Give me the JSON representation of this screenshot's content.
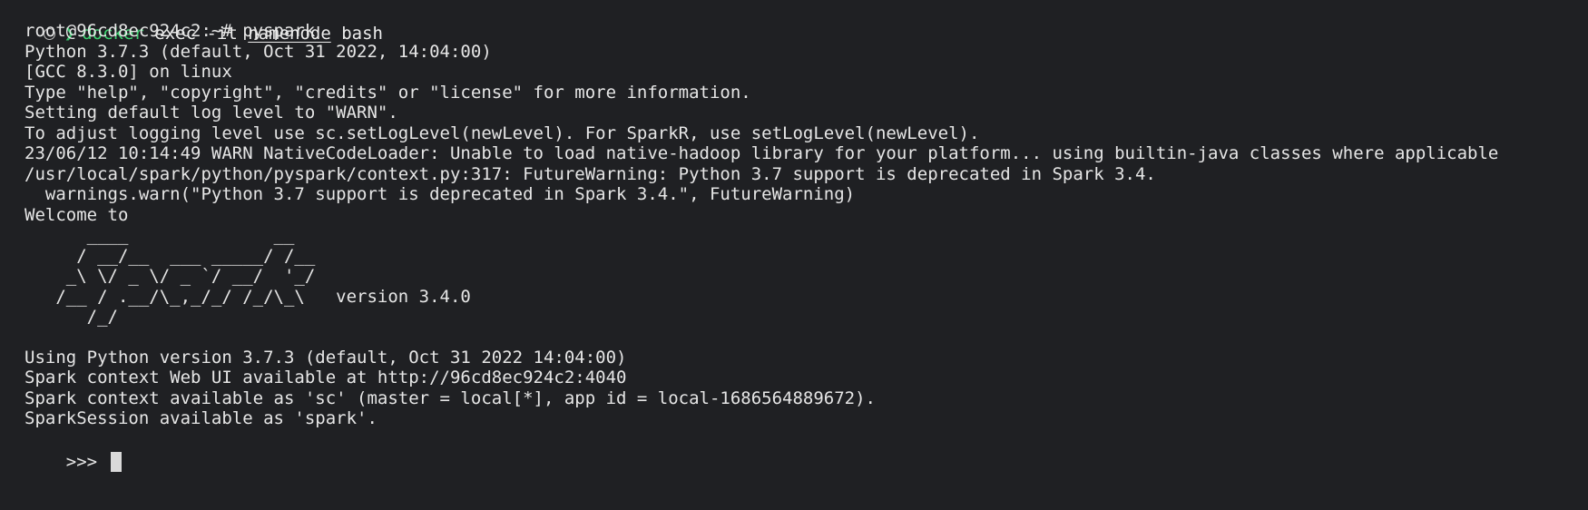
{
  "prompt": {
    "chevron": "❯",
    "command": "docker",
    "args_before": " exec -it ",
    "arg_underlined": "namenode",
    "args_after": " bash"
  },
  "lines": [
    "root@96cd8ec924c2:~# pyspark",
    "Python 3.7.3 (default, Oct 31 2022, 14:04:00)",
    "[GCC 8.3.0] on linux",
    "Type \"help\", \"copyright\", \"credits\" or \"license\" for more information.",
    "Setting default log level to \"WARN\".",
    "To adjust logging level use sc.setLogLevel(newLevel). For SparkR, use setLogLevel(newLevel).",
    "23/06/12 10:14:49 WARN NativeCodeLoader: Unable to load native-hadoop library for your platform... using builtin-java classes where applicable",
    "/usr/local/spark/python/pyspark/context.py:317: FutureWarning: Python 3.7 support is deprecated in Spark 3.4.",
    "  warnings.warn(\"Python 3.7 support is deprecated in Spark 3.4.\", FutureWarning)",
    "Welcome to"
  ],
  "ascii_art": [
    "      ____              __",
    "     / __/__  ___ _____/ /__",
    "    _\\ \\/ _ \\/ _ `/ __/  '_/",
    "   /__ / .__/\\_,_/_/ /_/\\_\\   version 3.4.0",
    "      /_/"
  ],
  "info_lines": [
    "Using Python version 3.7.3 (default, Oct 31 2022 14:04:00)",
    "Spark context Web UI available at http://96cd8ec924c2:4040",
    "Spark context available as 'sc' (master = local[*], app id = local-1686564889672).",
    "SparkSession available as 'spark'."
  ],
  "input_prompt": ">>> ",
  "colors": {
    "background": "#1f2023",
    "text": "#e6e6e6",
    "prompt_accent": "#3bd06f"
  }
}
